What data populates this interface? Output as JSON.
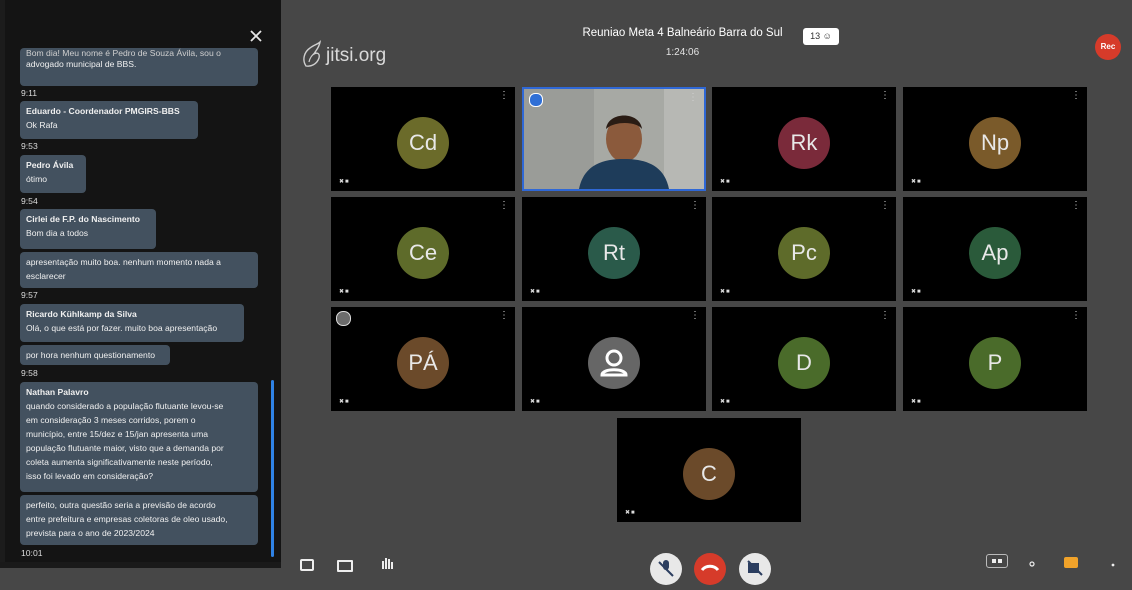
{
  "chat": {
    "close_icon": "close-icon",
    "messages": [
      {
        "sender": "",
        "text": "Bom dia! Meu nome é Pedro de Souza Ávila, sou o",
        "text2": "advogado municipal de BBS."
      },
      {
        "time": "9:11"
      },
      {
        "sender": "Eduardo - Coordenador PMGIRS-BBS",
        "text": "Ok Rafa"
      },
      {
        "time": "9:53"
      },
      {
        "sender": "Pedro Ávila",
        "text": "ótimo"
      },
      {
        "time": "9:54"
      },
      {
        "sender": "Cirlei de F.P. do Nascimento",
        "text": "Bom dia a todos"
      },
      {
        "text": "apresentação muito boa. nenhum momento nada a",
        "text2": "esclarecer"
      },
      {
        "time": "9:57"
      },
      {
        "sender": "Ricardo Kühlkamp da Silva",
        "text": "Olá, o que está por fazer. muito boa apresentação"
      },
      {
        "text": "por hora nenhum questionamento"
      },
      {
        "time": "9:58"
      },
      {
        "sender": "Nathan Palavro",
        "lines": [
          "quando considerado a população flutuante levou-se",
          "em consideração 3 meses corridos, porem o",
          "município, entre 15/dez e 15/jan apresenta uma",
          "população flutuante maior, visto que a demanda por",
          "coleta aumenta significativamente neste período,",
          "isso foi levado em consideração?"
        ]
      },
      {
        "lines": [
          "perfeito, outra questão seria a previsão de acordo",
          "entre prefeitura e empresas coletoras de oleo usado,",
          "prevista para o ano de 2023/2024"
        ]
      },
      {
        "time": "10:01"
      }
    ]
  },
  "header": {
    "logo_text": "jitsi.org",
    "meeting_title": "Reuniao Meta 4 Balneário Barra do Sul",
    "duration": "1:24:06",
    "participant_count": "13",
    "rec_label": "Rec"
  },
  "tiles": [
    {
      "initials": "Cd",
      "color": "#6b6b2a"
    },
    {
      "initials": "",
      "video": true
    },
    {
      "initials": "Rk",
      "color": "#7a2a3a"
    },
    {
      "initials": "Np",
      "color": "#7a5a2a"
    },
    {
      "initials": "Ce",
      "color": "#5e6b2a"
    },
    {
      "initials": "Rt",
      "color": "#2a5a4a"
    },
    {
      "initials": "Pc",
      "color": "#5e6b2a"
    },
    {
      "initials": "Ap",
      "color": "#2a5a3a"
    },
    {
      "initials": "PÁ",
      "color": "#6b4a2a"
    },
    {
      "initials": "",
      "generic": true,
      "color": "#666666"
    },
    {
      "initials": "D",
      "color": "#4a6b2a"
    },
    {
      "initials": "P",
      "color": "#4a6b2a"
    },
    {
      "initials": "C",
      "color": "#6b4a2a"
    }
  ],
  "tile_status": "mic-off-icon camera-off-icon",
  "colors": {
    "accent": "#2f68d6",
    "hangup": "#d63b2a",
    "chat_bubble": "#43515f"
  }
}
